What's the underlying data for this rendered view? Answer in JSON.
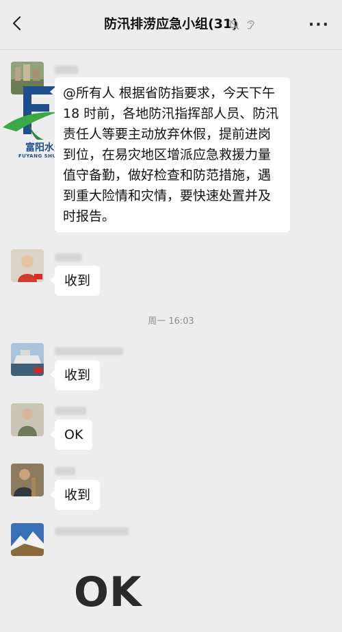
{
  "header": {
    "title": "防汛排涝应急小组(31)",
    "more": "···"
  },
  "watermark": {
    "name": "富阳水务",
    "sub": "FUYANG SHUI WU"
  },
  "messages": [
    {
      "text": "@所有人 根据省防指要求，今天下午 18 时前，各地防汛指挥部人员、防汛责任人等要主动放弃休假，提前进岗到位，在易灾地区增派应急救援力量值守备勤，做好检查和防范措施，遇到重大险情和灾情，要快速处置并及时报告。"
    },
    {
      "text": "收到"
    },
    {
      "text": "收到"
    },
    {
      "text": "OK"
    },
    {
      "text": "收到"
    }
  ],
  "timestamp": "周一 16:03",
  "big_text": "OK"
}
